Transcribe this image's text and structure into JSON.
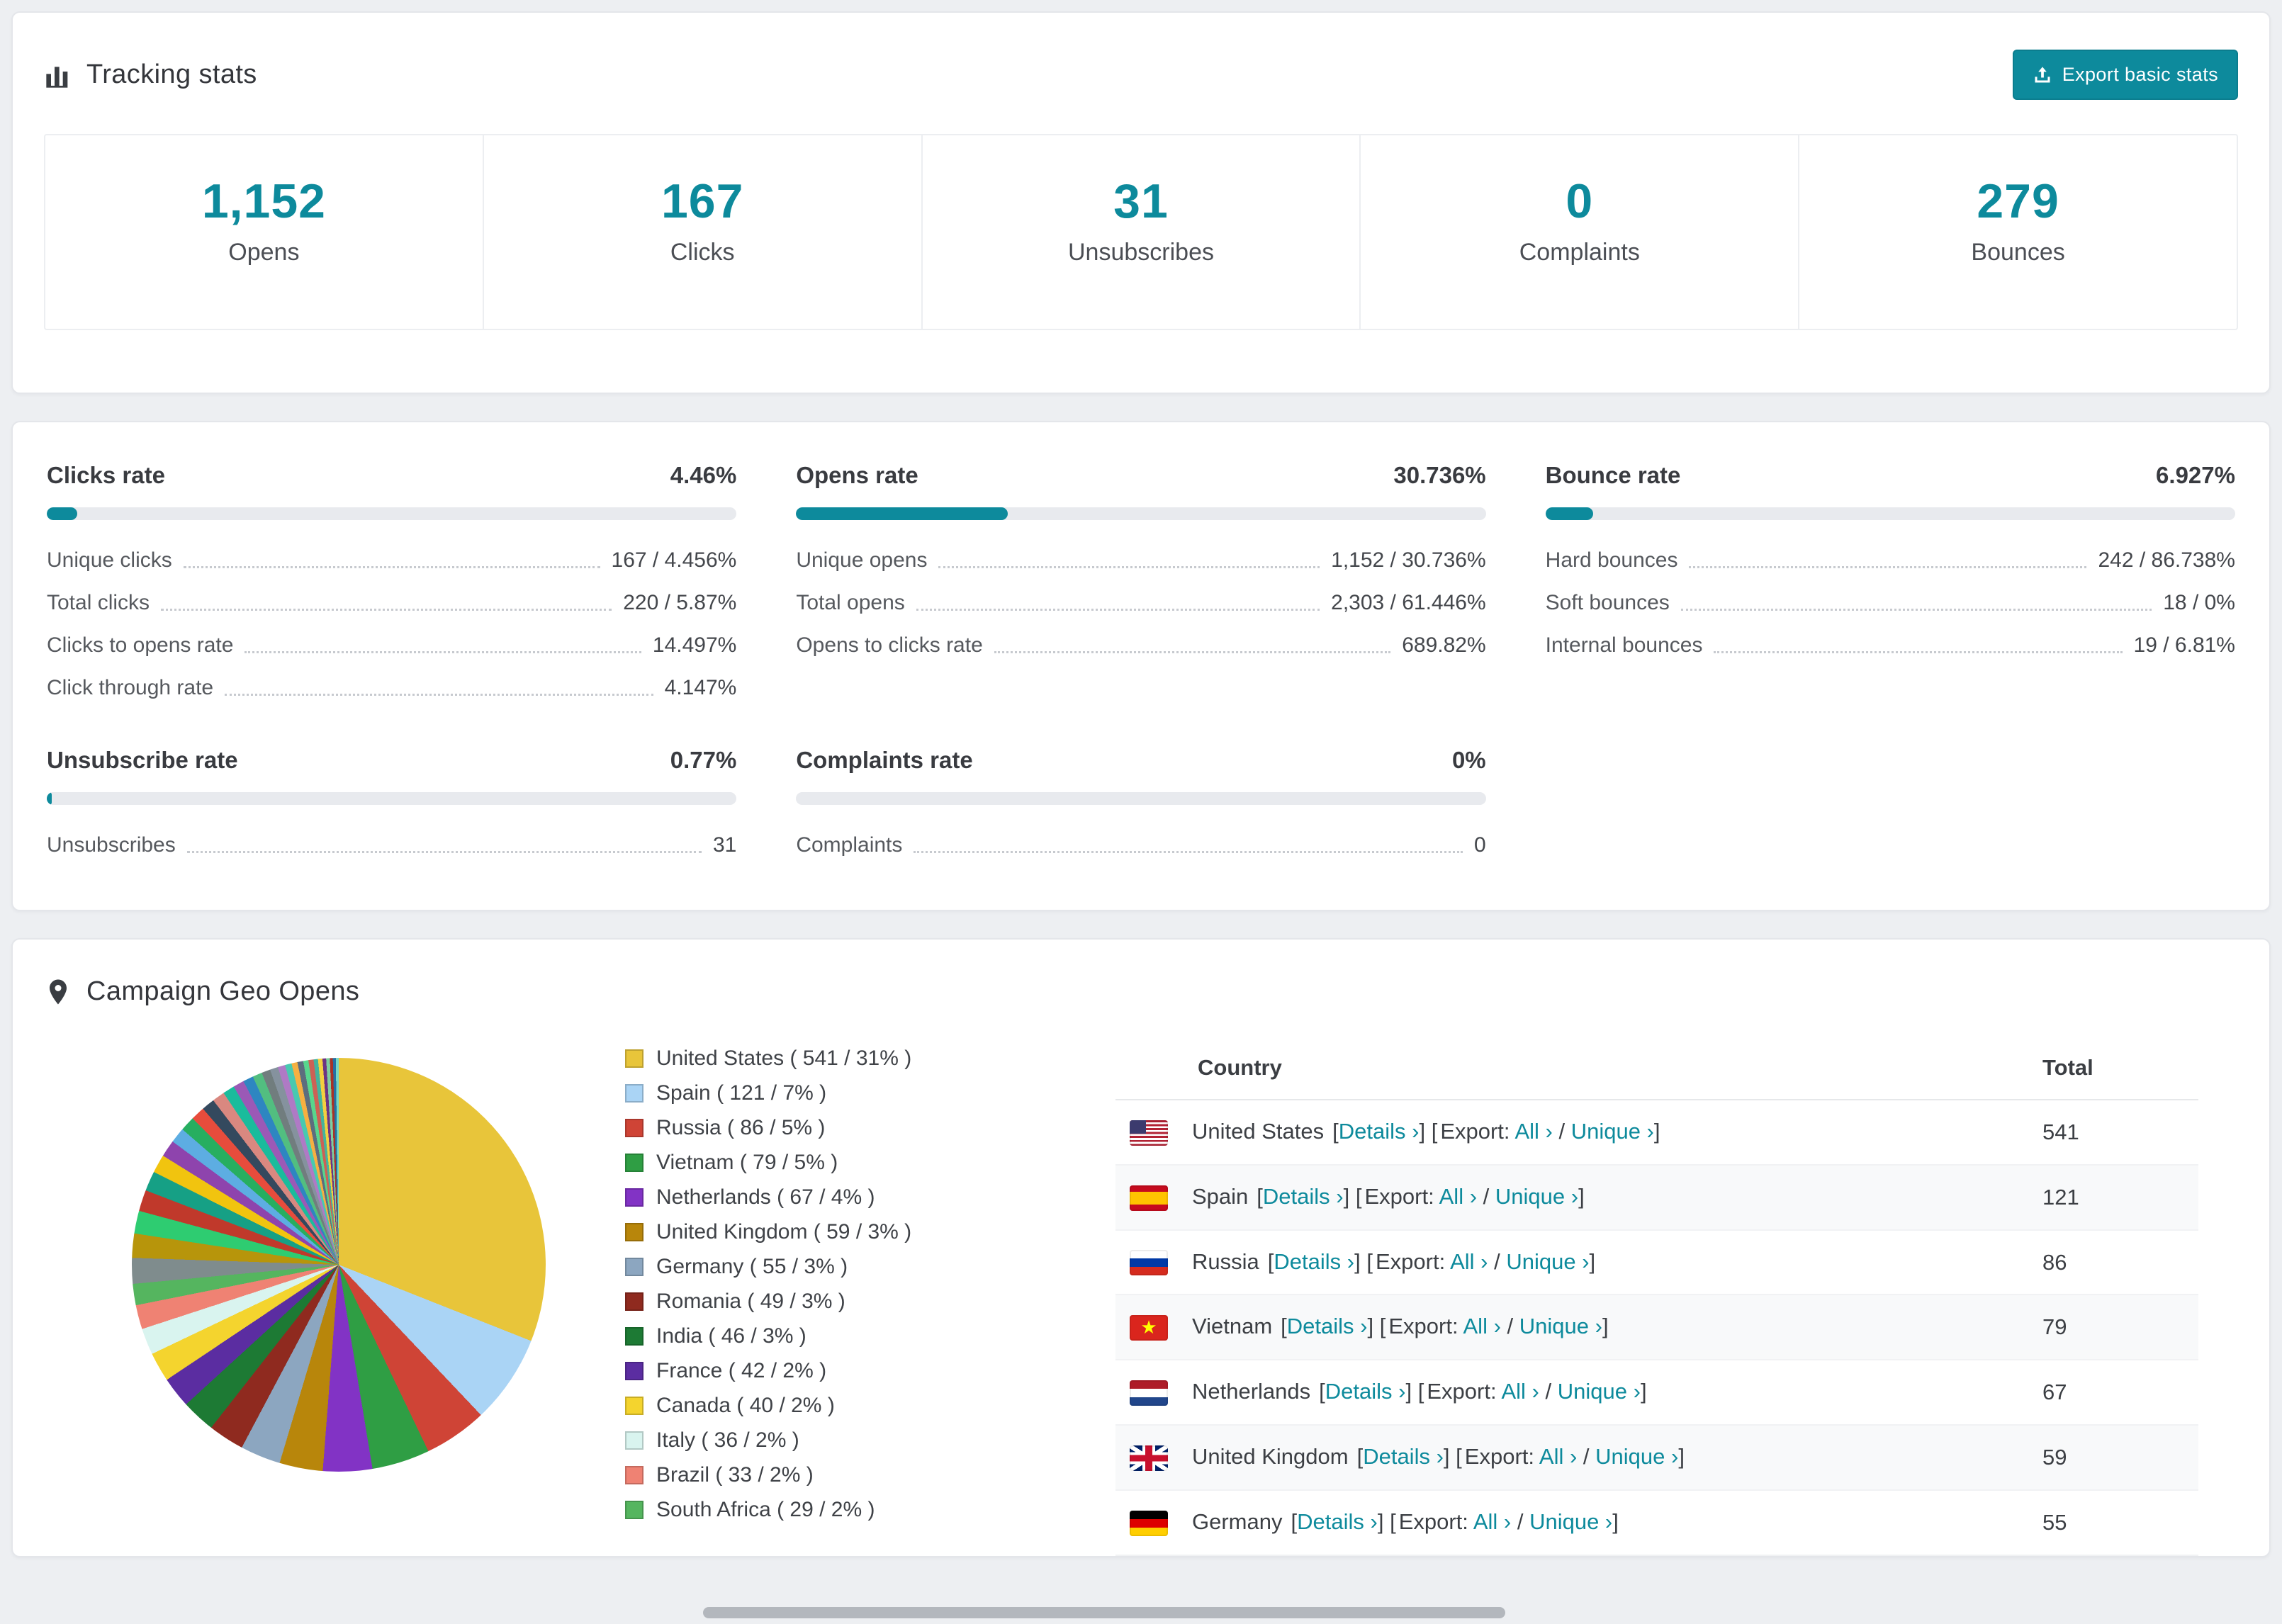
{
  "accent_color": "#0d8a9c",
  "accent_dark_color": "#0b7d8e",
  "tracking": {
    "title": "Tracking stats",
    "export_button_label": "Export basic stats",
    "stats": [
      {
        "value": "1,152",
        "label": "Opens"
      },
      {
        "value": "167",
        "label": "Clicks"
      },
      {
        "value": "31",
        "label": "Unsubscribes"
      },
      {
        "value": "0",
        "label": "Complaints"
      },
      {
        "value": "279",
        "label": "Bounces"
      }
    ]
  },
  "rates": [
    {
      "title": "Clicks rate",
      "value": "4.46%",
      "percent": 4.46,
      "rows": [
        {
          "label": "Unique clicks",
          "value": "167 / 4.456%"
        },
        {
          "label": "Total clicks",
          "value": "220 / 5.87%"
        },
        {
          "label": "Clicks to opens rate",
          "value": "14.497%"
        },
        {
          "label": "Click through rate",
          "value": "4.147%"
        }
      ]
    },
    {
      "title": "Opens rate",
      "value": "30.736%",
      "percent": 30.736,
      "rows": [
        {
          "label": "Unique opens",
          "value": "1,152 / 30.736%"
        },
        {
          "label": "Total opens",
          "value": "2,303 / 61.446%"
        },
        {
          "label": "Opens to clicks rate",
          "value": "689.82%"
        }
      ]
    },
    {
      "title": "Bounce rate",
      "value": "6.927%",
      "percent": 6.927,
      "rows": [
        {
          "label": "Hard bounces",
          "value": "242 / 86.738%"
        },
        {
          "label": "Soft bounces",
          "value": "18 / 0%"
        },
        {
          "label": "Internal bounces",
          "value": "19 / 6.81%"
        }
      ]
    },
    {
      "title": "Unsubscribe rate",
      "value": "0.77%",
      "percent": 0.77,
      "rows": [
        {
          "label": "Unsubscribes",
          "value": "31"
        }
      ]
    },
    {
      "title": "Complaints rate",
      "value": "0%",
      "percent": 0,
      "rows": [
        {
          "label": "Complaints",
          "value": "0"
        }
      ]
    }
  ],
  "geo": {
    "title": "Campaign Geo Opens",
    "table": {
      "headers": [
        "Country",
        "Total"
      ],
      "labels": {
        "bracket_open": "[",
        "bracket_close": "]",
        "details": "Details ›",
        "export": "Export:",
        "all": "All ›",
        "separator": "/",
        "unique": "Unique ›"
      },
      "rows": [
        {
          "country": "United States",
          "flag": "us",
          "total": "541"
        },
        {
          "country": "Spain",
          "flag": "es",
          "total": "121"
        },
        {
          "country": "Russia",
          "flag": "ru",
          "total": "86"
        },
        {
          "country": "Vietnam",
          "flag": "vn",
          "total": "79"
        },
        {
          "country": "Netherlands",
          "flag": "nl",
          "total": "67"
        },
        {
          "country": "United Kingdom",
          "flag": "gb",
          "total": "59"
        },
        {
          "country": "Germany",
          "flag": "de",
          "total": "55"
        }
      ]
    }
  },
  "chart_data": {
    "type": "pie",
    "title": "Campaign Geo Opens",
    "legend_position": "right",
    "slices": [
      {
        "label": "United States",
        "value": 541,
        "percent": 31,
        "color": "#e8c53a"
      },
      {
        "label": "Spain",
        "value": 121,
        "percent": 7,
        "color": "#aad4f5"
      },
      {
        "label": "Russia",
        "value": 86,
        "percent": 5,
        "color": "#cf4436"
      },
      {
        "label": "Vietnam",
        "value": 79,
        "percent": 5,
        "color": "#2f9e44"
      },
      {
        "label": "Netherlands",
        "value": 67,
        "percent": 4,
        "color": "#8233c5"
      },
      {
        "label": "United Kingdom",
        "value": 59,
        "percent": 3,
        "color": "#b8860b"
      },
      {
        "label": "Germany",
        "value": 55,
        "percent": 3,
        "color": "#8ca6c0"
      },
      {
        "label": "Romania",
        "value": 49,
        "percent": 3,
        "color": "#8f2a1f"
      },
      {
        "label": "India",
        "value": 46,
        "percent": 3,
        "color": "#1d7a34"
      },
      {
        "label": "France",
        "value": 42,
        "percent": 2,
        "color": "#5b2da1"
      },
      {
        "label": "Canada",
        "value": 40,
        "percent": 2,
        "color": "#f4d42e"
      },
      {
        "label": "Italy",
        "value": 36,
        "percent": 2,
        "color": "#d9f4ef"
      },
      {
        "label": "Brazil",
        "value": 33,
        "percent": 2,
        "color": "#ef8273"
      },
      {
        "label": "South Africa",
        "value": 29,
        "percent": 2,
        "color": "#55b55f"
      }
    ],
    "unlabeled_small_slices": {
      "values": [
        35,
        33,
        31,
        29,
        27,
        25,
        23,
        21,
        20,
        19,
        18,
        17,
        16,
        15,
        14,
        13,
        12,
        11,
        10,
        9,
        8,
        8,
        7,
        7,
        6,
        6,
        5,
        5,
        4,
        4,
        4
      ],
      "colors": [
        "#7f8c8d",
        "#b7950b",
        "#2ecc71",
        "#c0392b",
        "#16a085",
        "#f1c40f",
        "#8e44ad",
        "#5dade2",
        "#27ae60",
        "#e74c3c",
        "#34495e",
        "#d98880",
        "#1abc9c",
        "#9b59b6",
        "#2e86c1",
        "#52be80",
        "#717d7e",
        "#85929e",
        "#af7ac5",
        "#48c9b0",
        "#f5b041",
        "#5d6d7e",
        "#58d68d",
        "#cd6155",
        "#45b39d",
        "#f4d03f",
        "#6c3483",
        "#7dcea0",
        "#a93226",
        "#2471a3",
        "#76d7c4"
      ]
    }
  }
}
